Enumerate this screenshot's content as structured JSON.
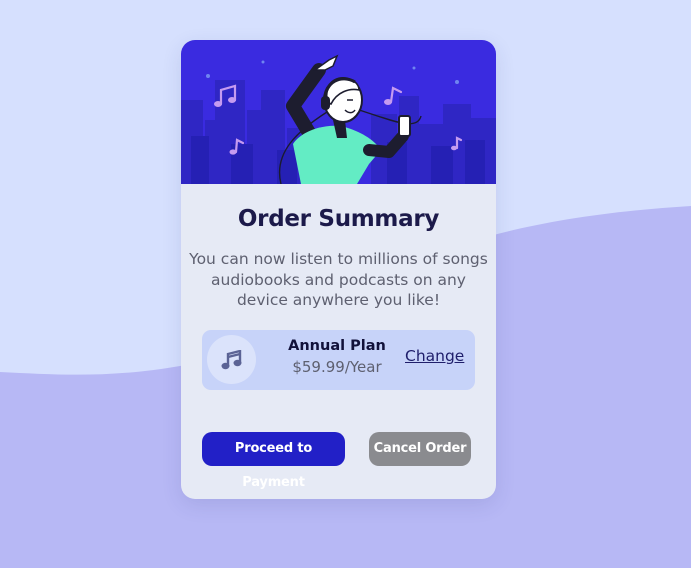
{
  "colors": {
    "page_background": "#d6e0fe",
    "wave": "#b7b8f5",
    "card_background": "#e6eaf5",
    "hero_background": "#3a2be0",
    "plan_background": "#c7d3f9",
    "primary_button": "#2220c7",
    "secondary_button": "#8a8b8f",
    "title": "#1c1a4a",
    "body_text": "#5e6070"
  },
  "hero": {
    "illustration": "person-dancing-with-headphones-illustration"
  },
  "card": {
    "title": "Order Summary",
    "description": "You can now listen to millions of songs audiobooks and podcasts on any device anywhere you like!"
  },
  "plan": {
    "icon": "music-note-icon",
    "name": "Annual Plan",
    "price": "$59.99/Year",
    "change_label": "Change"
  },
  "actions": {
    "proceed_label": "Proceed to Payment",
    "cancel_label": "Cancel Order"
  }
}
